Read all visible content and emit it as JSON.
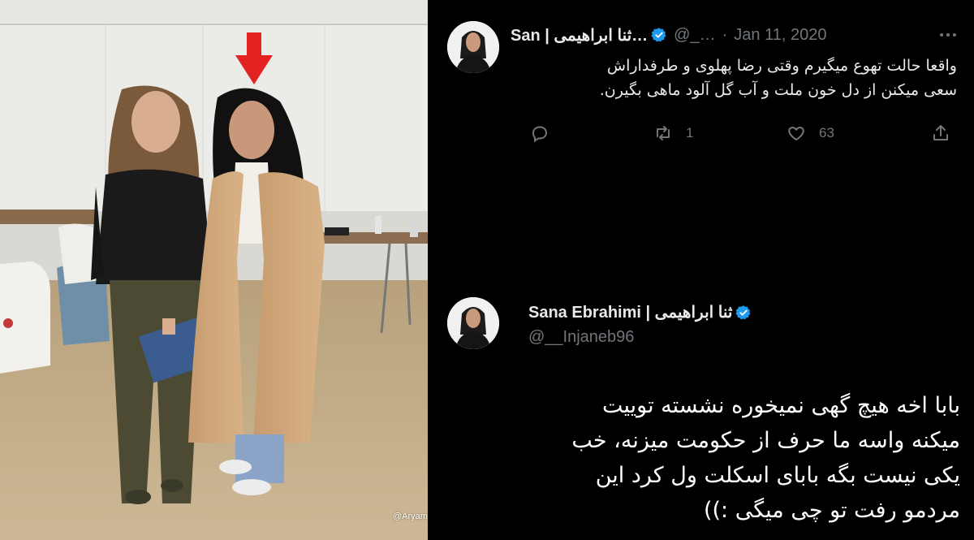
{
  "photo": {
    "watermark": "@Aryamihan"
  },
  "tweet1": {
    "display_name": "San | ثنا ابراهیمی…",
    "handle": "@_…",
    "separator": "·",
    "date": "Jan 11, 2020",
    "text_lines": [
      "واقعا حالت تهوع میگیرم وقتی رضا پهلوی و طرفداراش",
      "سعی میکنن از دل خون ملت و آب گل آلود ماهی بگیرن."
    ],
    "retweets": "1",
    "likes": "63"
  },
  "tweet2": {
    "display_name": "Sana Ebrahimi | ثنا ابراهیمی",
    "handle": "@__Injaneb96",
    "text_lines": [
      "بابا اخه هیچ گهی نمیخوره نشسته توییت",
      "میکنه واسه ما حرف از حکومت میزنه، خب",
      "یکی نیست بگه بابای اسکلت ول کرد این",
      "مردمو رفت تو چی میگی :))"
    ]
  },
  "icons": [
    "reply-icon",
    "retweet-icon",
    "like-icon",
    "share-icon",
    "verified-badge-icon",
    "more-icon",
    "red-arrow-icon"
  ],
  "colors": {
    "background": "#000000",
    "text": "#e7e9ea",
    "muted": "#71767b",
    "verified": "#1d9bf0",
    "arrow": "#e32222"
  }
}
